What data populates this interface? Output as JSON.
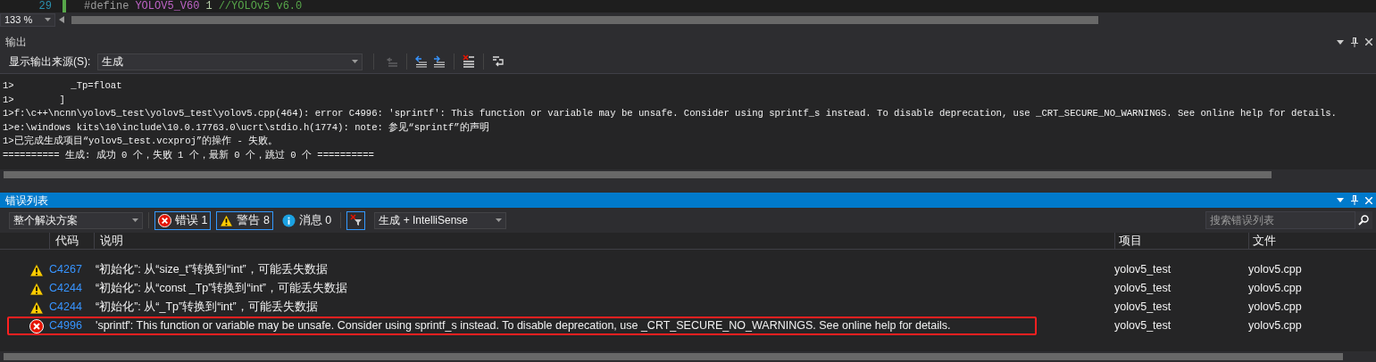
{
  "editor": {
    "line_number": "29",
    "code_keyword": "#define",
    "code_macro": "YOLOV5_V60",
    "code_value": "1",
    "code_comment": "//YOLOv5 v6.0",
    "zoom": "133 %"
  },
  "output": {
    "title": "输出",
    "source_label": "显示输出来源(S):",
    "source_value": "生成",
    "lines": [
      "1>          _Tp=float",
      "1>        ]",
      "1>f:\\c++\\ncnn\\yolov5_test\\yolov5_test\\yolov5.cpp(464): error C4996: 'sprintf': This function or variable may be unsafe. Consider using sprintf_s instead. To disable deprecation, use _CRT_SECURE_NO_WARNINGS. See online help for details.",
      "1>e:\\windows kits\\10\\include\\10.0.17763.0\\ucrt\\stdio.h(1774): note: 参见“sprintf”的声明",
      "1>已完成生成项目“yolov5_test.vcxproj”的操作 - 失败。",
      "========== 生成: 成功 0 个，失败 1 个，最新 0 个，跳过 0 个 =========="
    ]
  },
  "error_list": {
    "title": "错误列表",
    "scope": "整个解决方案",
    "filters": [
      {
        "kind": "error",
        "label": "错误 1",
        "selected": true
      },
      {
        "kind": "warning",
        "label": "警告 8",
        "selected": true
      },
      {
        "kind": "info",
        "label": "消息 0",
        "selected": false
      }
    ],
    "filter_toggle": {
      "selected": true
    },
    "build_source": "生成 + IntelliSense",
    "search": {
      "placeholder": "搜索错误列表"
    },
    "columns": [
      "代码",
      "说明",
      "项目",
      "文件"
    ],
    "rows": [
      {
        "kind": "warning",
        "code": "C4267",
        "description": "“初始化”: 从“size_t”转换到“int”，可能丢失数据",
        "project": "yolov5_test",
        "file": "yolov5.cpp",
        "highlighted": false
      },
      {
        "kind": "warning",
        "code": "C4244",
        "description": "“初始化”: 从“const _Tp”转换到“int”，可能丢失数据",
        "project": "yolov5_test",
        "file": "yolov5.cpp",
        "highlighted": false
      },
      {
        "kind": "warning",
        "code": "C4244",
        "description": "“初始化”: 从“_Tp”转换到“int”，可能丢失数据",
        "project": "yolov5_test",
        "file": "yolov5.cpp",
        "highlighted": false
      },
      {
        "kind": "error",
        "code": "C4996",
        "description": "'sprintf': This function or variable may be unsafe. Consider using sprintf_s instead. To disable deprecation, use _CRT_SECURE_NO_WARNINGS. See online help for details.",
        "project": "yolov5_test",
        "file": "yolov5.cpp",
        "highlighted": true
      }
    ]
  }
}
